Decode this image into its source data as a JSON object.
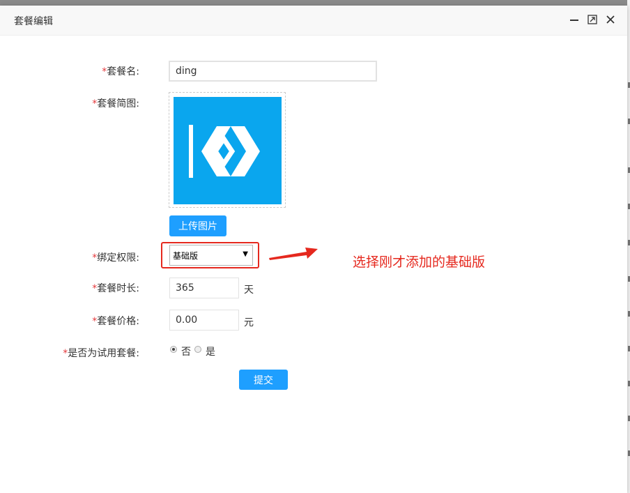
{
  "dialog": {
    "title": "套餐编辑",
    "controls": {
      "minimize": "minimize-icon",
      "maximize": "maximize-icon",
      "close": "close-icon"
    }
  },
  "form": {
    "required_mark": "*",
    "name": {
      "label": "套餐名:",
      "value": "ding"
    },
    "image": {
      "label": "套餐简图:",
      "upload_label": "上传图片",
      "logo_color": "#0aa6ee"
    },
    "permission": {
      "label": "绑定权限:",
      "selected": "基础版"
    },
    "duration": {
      "label": "套餐时长:",
      "value": "365",
      "unit": "天"
    },
    "price": {
      "label": "套餐价格:",
      "value": "0.00",
      "unit": "元"
    },
    "trial": {
      "label": "是否为试用套餐:",
      "options": [
        {
          "label": "否",
          "checked": true
        },
        {
          "label": "是",
          "checked": false
        }
      ]
    },
    "submit_label": "提交"
  },
  "annotation": {
    "text": "选择刚才添加的基础版",
    "color": "#e5281e"
  },
  "colors": {
    "primary": "#1e9fff",
    "required": "#e4393c"
  }
}
